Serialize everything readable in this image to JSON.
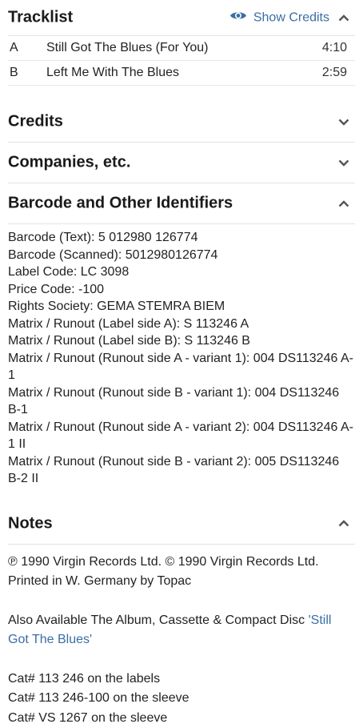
{
  "tracklist": {
    "title": "Tracklist",
    "show_credits_label": "Show Credits",
    "tracks": [
      {
        "position": "A",
        "title": "Still Got The Blues (For You)",
        "duration": "4:10"
      },
      {
        "position": "B",
        "title": "Left Me With The Blues",
        "duration": "2:59"
      }
    ]
  },
  "credits": {
    "title": "Credits"
  },
  "companies": {
    "title": "Companies, etc."
  },
  "identifiers": {
    "title": "Barcode and Other Identifiers",
    "lines": [
      "Barcode (Text): 5 012980 126774",
      "Barcode (Scanned): 5012980126774",
      "Label Code: LC 3098",
      "Price Code: -100",
      "Rights Society: GEMA STEMRA BIEM",
      "Matrix / Runout (Label side A): S 113246 A",
      "Matrix / Runout (Label side B): S 113246 B",
      "Matrix / Runout (Runout side A - variant 1): 004 DS113246 A-1",
      "Matrix / Runout (Runout side B - variant 1): 004 DS113246 B-1",
      "Matrix / Runout (Runout side A - variant 2): 004 DS113246 A-1 II",
      "Matrix / Runout (Runout side B - variant 2): 005 DS113246 B-2 II"
    ]
  },
  "notes": {
    "title": "Notes",
    "p1": "℗ 1990 Virgin Records Ltd. © 1990 Virgin Records Ltd. Printed in W. Germany by Topac",
    "p2_text": "Also Available The Album, Cassette & Compact Disc ",
    "p2_link": "'Still Got The Blues'",
    "cat_lines": [
      "Cat# 113 246 on the labels",
      "Cat# 113 246-100 on the sleeve",
      "Cat# VS 1267 on the sleeve"
    ]
  },
  "colors": {
    "link": "#3a6ea5",
    "chevron": "#555555"
  }
}
